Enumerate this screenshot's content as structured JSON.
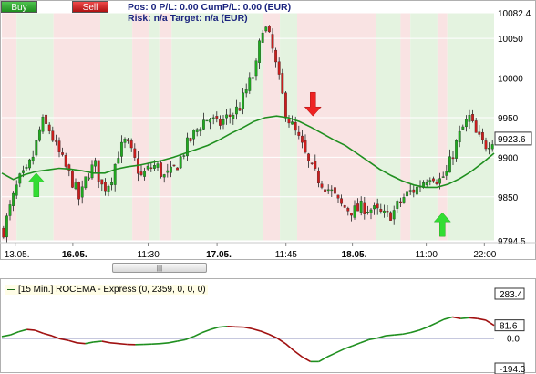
{
  "toolbar": {
    "buy_label": "Buy",
    "sell_label": "Sell"
  },
  "info": {
    "line1": "Pos: 0  P/L: 0.00  CumP/L: 0.00 (EUR)",
    "line2": "Risk: n/a  Target: n/a (EUR)"
  },
  "scrollbar": {
    "grip": "|||"
  },
  "indicator": {
    "title": "[15 Min.] ROCEMA - Express  (0, 2359, 0, 0, 0)"
  },
  "colors": {
    "bull": "#1faa1f",
    "bear": "#cc1d1d",
    "ma": "#1f8f1f",
    "long_bg": "#e4f3e0",
    "short_bg": "#f9e3e3",
    "osc_up": "#1f8f1f",
    "osc_down": "#a01010"
  },
  "chart_data": [
    {
      "type": "candlestick",
      "ylim": [
        9794.5,
        10082.4
      ],
      "y_ticks": [
        10082.4,
        10050,
        10000,
        9950,
        9900,
        9850,
        9794.5
      ],
      "last_price": 9923.6,
      "x_tick_labels": [
        {
          "label": "13.05.",
          "bold": false
        },
        {
          "label": "16.05.",
          "bold": true
        },
        {
          "label": "11:30",
          "bold": false
        },
        {
          "label": "17.05.",
          "bold": true
        },
        {
          "label": "11:45",
          "bold": false
        },
        {
          "label": "18.05.",
          "bold": true
        },
        {
          "label": "11:00",
          "bold": false
        },
        {
          "label": "22:00",
          "bold": false
        }
      ],
      "close_path": [
        9808,
        9840,
        9870,
        9880,
        9905,
        9945,
        9935,
        9910,
        9890,
        9870,
        9845,
        9880,
        9890,
        9860,
        9870,
        9905,
        9920,
        9900,
        9875,
        9885,
        9890,
        9875,
        9880,
        9895,
        9915,
        9930,
        9945,
        9950,
        9940,
        9948,
        9955,
        9965,
        9990,
        10010,
        10070,
        10045,
        10000,
        9955,
        9935,
        9915,
        9890,
        9875,
        9865,
        9855,
        9840,
        9835,
        9832,
        9837,
        9835,
        9830,
        9825,
        9830,
        9845,
        9855,
        9860,
        9870,
        9880,
        9870,
        9880,
        9910,
        9935,
        9950,
        9925,
        9915,
        9923.6
      ],
      "ma_path": [
        9880,
        9872,
        9878,
        9882,
        9884,
        9886,
        9885,
        9883,
        9880,
        9880,
        9885,
        9888,
        9890,
        9893,
        9896,
        9900,
        9905,
        9910,
        9915,
        9922,
        9930,
        9937,
        9945,
        9950,
        9952,
        9950,
        9945,
        9938,
        9930,
        9922,
        9915,
        9905,
        9895,
        9885,
        9877,
        9870,
        9865,
        9862,
        9862,
        9866,
        9873,
        9882,
        9893,
        9905
      ],
      "shade_segments": [
        {
          "side": "short",
          "start": 0,
          "end": 0.03
        },
        {
          "side": "long",
          "start": 0.03,
          "end": 0.105
        },
        {
          "side": "short",
          "start": 0.105,
          "end": 0.2
        },
        {
          "side": "long",
          "start": 0.2,
          "end": 0.265
        },
        {
          "side": "short",
          "start": 0.265,
          "end": 0.3
        },
        {
          "side": "long",
          "start": 0.3,
          "end": 0.32
        },
        {
          "side": "short",
          "start": 0.32,
          "end": 0.345
        },
        {
          "side": "long",
          "start": 0.345,
          "end": 0.53
        },
        {
          "side": "short",
          "start": 0.53,
          "end": 0.565
        },
        {
          "side": "long",
          "start": 0.565,
          "end": 0.6
        },
        {
          "side": "short",
          "start": 0.6,
          "end": 0.76
        },
        {
          "side": "long",
          "start": 0.76,
          "end": 0.81
        },
        {
          "side": "short",
          "start": 0.81,
          "end": 0.83
        },
        {
          "side": "long",
          "start": 0.83,
          "end": 0.885
        },
        {
          "side": "short",
          "start": 0.885,
          "end": 0.905
        },
        {
          "side": "long",
          "start": 0.905,
          "end": 1.0
        }
      ],
      "signals": [
        {
          "type": "buy",
          "x_frac": 0.07,
          "price": 9880
        },
        {
          "type": "sell",
          "x_frac": 0.632,
          "price": 9952
        },
        {
          "type": "buy",
          "x_frac": 0.895,
          "price": 9830
        }
      ]
    },
    {
      "type": "line",
      "ylim": [
        -194.3,
        283.4
      ],
      "y_ticks": [
        283.4,
        81.6,
        0.0,
        -194.3
      ],
      "series": [
        {
          "values": [
            10,
            20,
            40,
            55,
            50,
            30,
            15,
            -5,
            -15,
            -30,
            -35,
            -25,
            -20,
            -30,
            -35,
            -40,
            -42,
            -40,
            -38,
            -35,
            -30,
            -20,
            -10,
            10,
            35,
            55,
            70,
            75,
            72,
            70,
            60,
            45,
            25,
            0,
            -35,
            -80,
            -120,
            -150,
            -150,
            -120,
            -95,
            -70,
            -50,
            -30,
            -10,
            0,
            15,
            20,
            25,
            35,
            50,
            70,
            95,
            120,
            135,
            125,
            130,
            125,
            115,
            81.6
          ]
        }
      ]
    }
  ]
}
